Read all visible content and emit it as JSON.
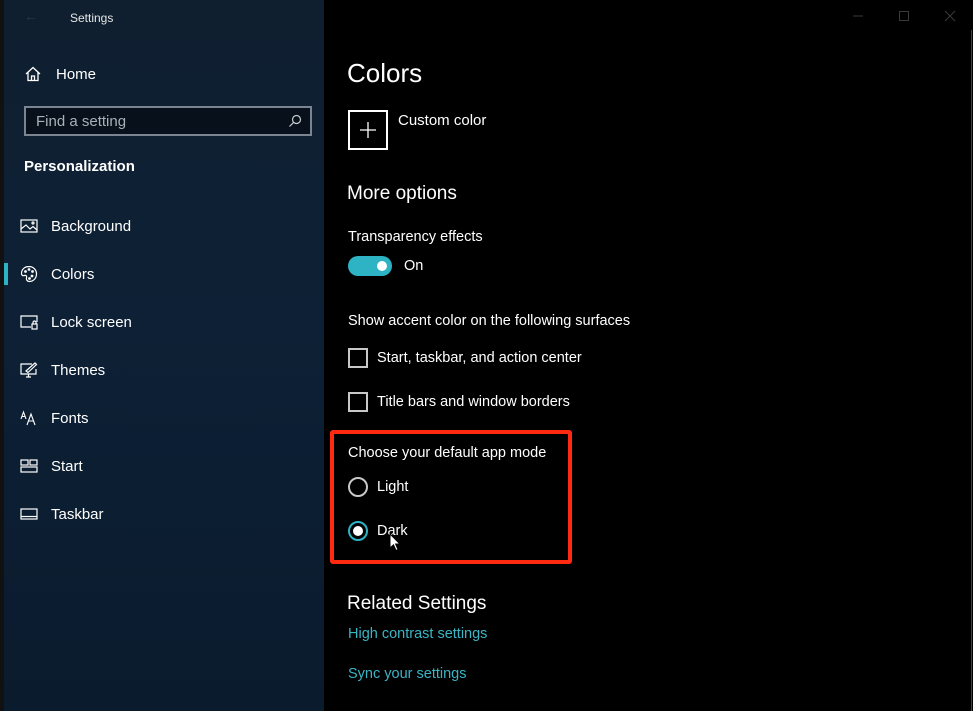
{
  "window": {
    "title": "Settings",
    "controls": {
      "minimize": "minimize-icon",
      "maximize": "maximize-icon",
      "close": "close-icon"
    }
  },
  "sidebar": {
    "home_label": "Home",
    "search_placeholder": "Find a setting",
    "search_value": "",
    "section_title": "Personalization",
    "items": [
      {
        "label": "Background",
        "icon": "picture-icon",
        "active": false
      },
      {
        "label": "Colors",
        "icon": "palette-icon",
        "active": true
      },
      {
        "label": "Lock screen",
        "icon": "lock-screen-icon",
        "active": false
      },
      {
        "label": "Themes",
        "icon": "themes-icon",
        "active": false
      },
      {
        "label": "Fonts",
        "icon": "fonts-icon",
        "active": false
      },
      {
        "label": "Start",
        "icon": "start-icon",
        "active": false
      },
      {
        "label": "Taskbar",
        "icon": "taskbar-icon",
        "active": false
      }
    ]
  },
  "main": {
    "page_title": "Colors",
    "custom_color_label": "Custom color",
    "more_options_title": "More options",
    "transparency": {
      "label": "Transparency effects",
      "state_label": "On",
      "on": true
    },
    "accent_surfaces": {
      "label": "Show accent color on the following surfaces",
      "options": [
        {
          "label": "Start, taskbar, and action center",
          "checked": false
        },
        {
          "label": "Title bars and window borders",
          "checked": false
        }
      ]
    },
    "app_mode": {
      "label": "Choose your default app mode",
      "options": [
        {
          "label": "Light",
          "selected": false
        },
        {
          "label": "Dark",
          "selected": true
        }
      ]
    },
    "related": {
      "title": "Related Settings",
      "links": [
        "High contrast settings",
        "Sync your settings"
      ]
    }
  },
  "colors": {
    "accent": "#2db3c4",
    "link": "#3ab5c6",
    "highlight": "#ff2a10",
    "sidebar_bg": "#0d2035",
    "content_bg": "#000000"
  }
}
